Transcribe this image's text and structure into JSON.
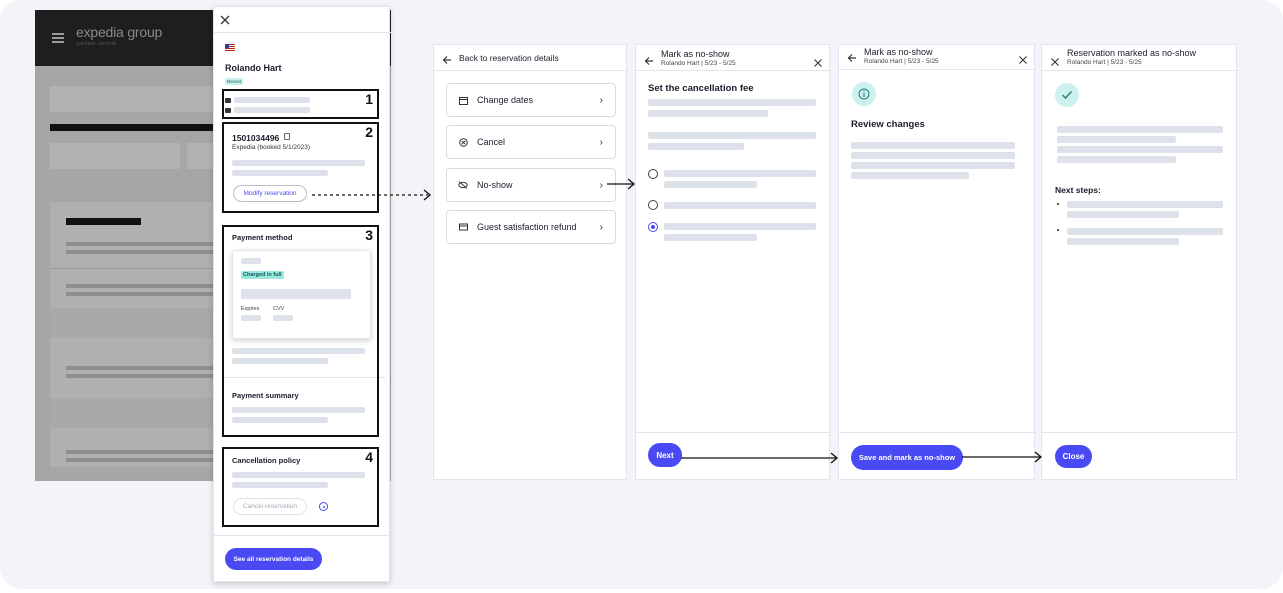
{
  "colors": {
    "accent": "#4a4af4",
    "success_bg": "#c7f0ec",
    "info_bg": "#cdf1ee",
    "dark_header": "#1e1e1e"
  },
  "background_app": {
    "logo": "expedia group",
    "logo_sub": "partner central",
    "menu_icon": "hamburger-icon"
  },
  "drawer": {
    "close_icon": "close-icon",
    "flag_icon": "us-flag-icon",
    "guest_name": "Rolando Hart",
    "guest_badge": "Recent",
    "contact_number": "1",
    "reservation": {
      "id": "1501034496",
      "source": "Expedia (booked 5/1/2023)",
      "modify_label": "Modify reservation",
      "box_number": "2"
    },
    "payment": {
      "title": "Payment method",
      "badge": "Charged in full",
      "expires_label": "Expires",
      "cvv_label": "CVV",
      "summary_title": "Payment summary",
      "box_number": "3"
    },
    "cancellation": {
      "title": "Cancellation policy",
      "cancel_label": "Cancel reservation",
      "box_number": "4"
    },
    "see_all_label": "See all reservation details"
  },
  "menu_screen": {
    "back_label": "Back to reservation details",
    "items": [
      {
        "label": "Change dates",
        "icon": "calendar-icon"
      },
      {
        "label": "Cancel",
        "icon": "cancel-circle-icon"
      },
      {
        "label": "No-show",
        "icon": "eye-off-icon"
      },
      {
        "label": "Guest satisfaction refund",
        "icon": "card-icon"
      }
    ]
  },
  "step1": {
    "title": "Mark as no-show",
    "subtitle": "Rolando Hart | 5/23 - 5/25",
    "heading": "Set the cancellation fee",
    "next_label": "Next"
  },
  "step2": {
    "title": "Mark as no-show",
    "subtitle": "Rolando Hart | 5/23 - 5/25",
    "heading": "Review changes",
    "save_label": "Save and mark as no-show"
  },
  "step3": {
    "title": "Reservation marked as no-show",
    "subtitle": "Rolando Hart | 5/23 - 5/25",
    "next_steps_label": "Next steps:",
    "close_label": "Close"
  }
}
